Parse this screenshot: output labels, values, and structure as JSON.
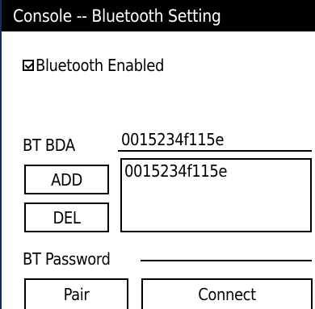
{
  "window": {
    "title": "Console -- Bluetooth Setting"
  },
  "settings": {
    "bluetooth_enabled_label": "Bluetooth Enabled",
    "bluetooth_enabled": true,
    "bda_label": "BT BDA",
    "bda_value": "0015234f115e",
    "password_label": "BT Password"
  },
  "device_list": {
    "items": [
      "0015234f115e"
    ]
  },
  "buttons": {
    "add_label": "ADD",
    "del_label": "DEL",
    "pair_label": "Pair",
    "connect_label": "Connect"
  },
  "colors": {
    "titlebar_bg": "#000000",
    "titlebar_text": "#ffffff",
    "background": "#ffffff",
    "foreground": "#000000"
  },
  "icons": {
    "checkbox": "checkbox-checked-icon"
  }
}
